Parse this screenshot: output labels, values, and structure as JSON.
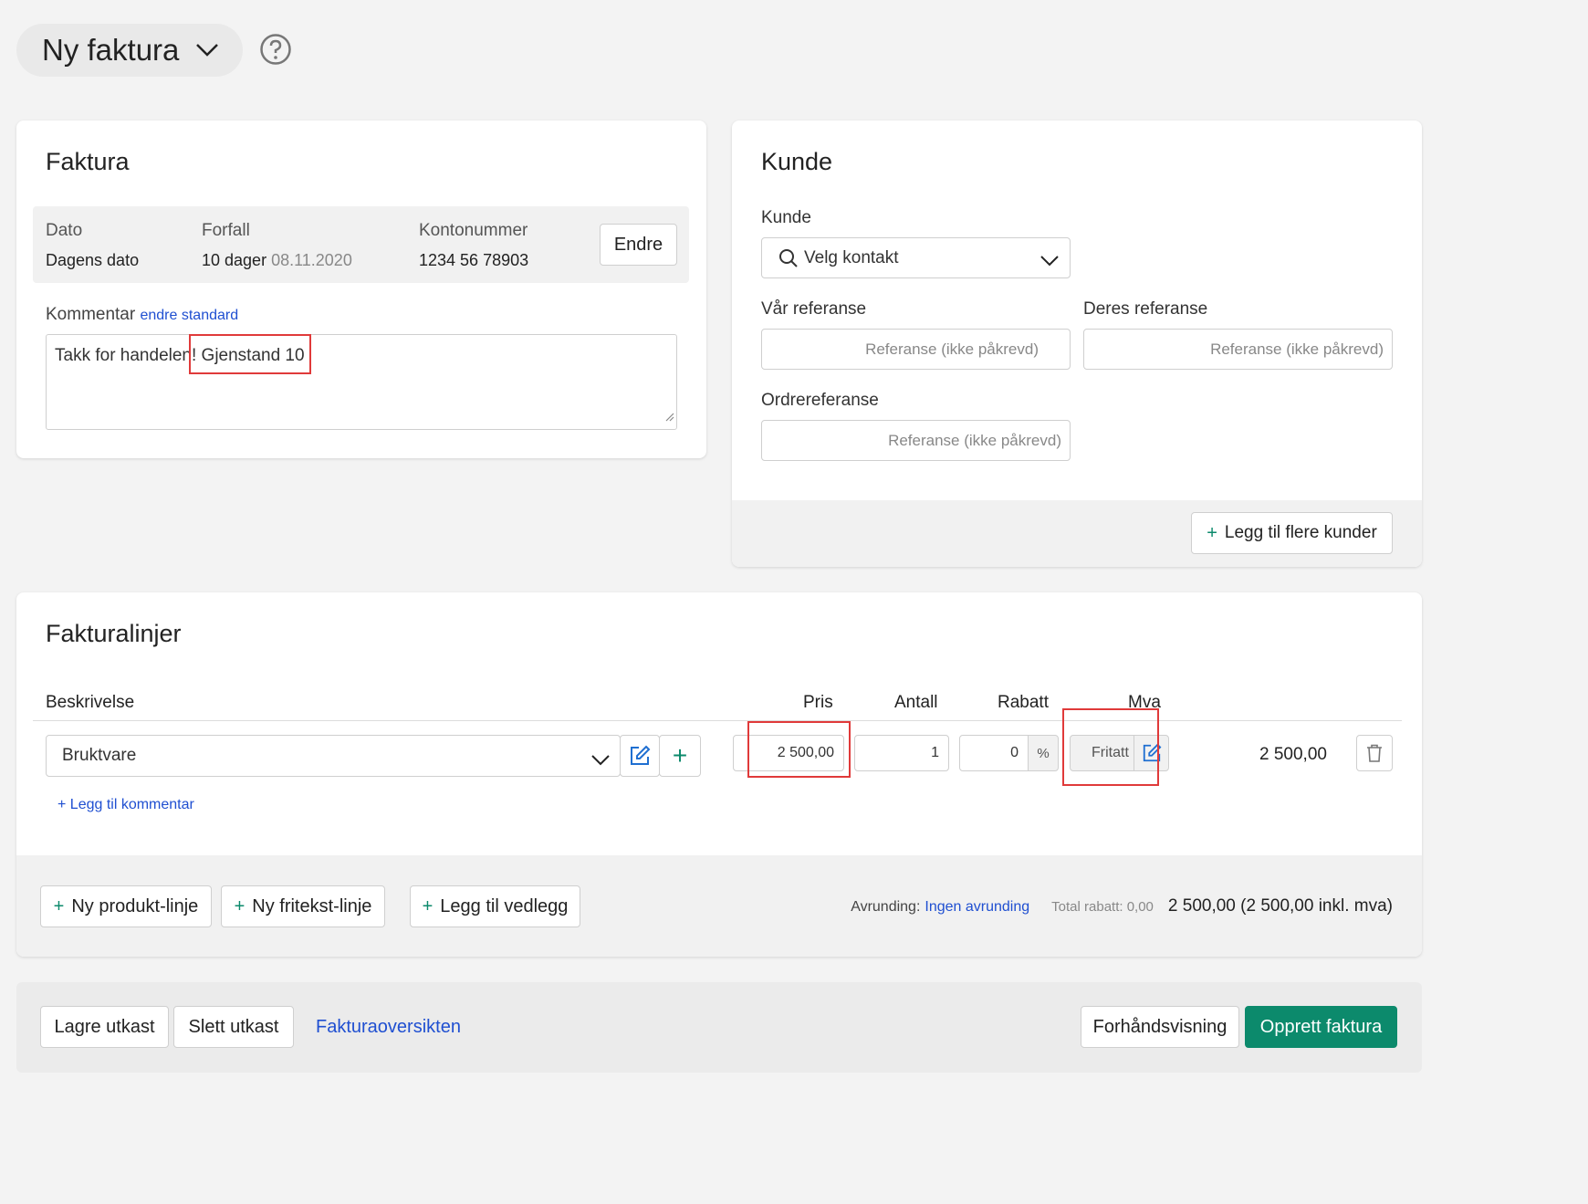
{
  "header": {
    "title": "Ny faktura"
  },
  "faktura": {
    "title": "Faktura",
    "dato_label": "Dato",
    "dato_value": "Dagens dato",
    "forfall_label": "Forfall",
    "forfall_value": "10 dager",
    "forfall_date": "08.11.2020",
    "konto_label": "Kontonummer",
    "konto_value": "1234 56 78903",
    "endre_label": "Endre",
    "kommentar_label": "Kommentar",
    "kommentar_link": "endre standard",
    "kommentar_text": "Takk for handelen! Gjenstand 10"
  },
  "kunde": {
    "title": "Kunde",
    "kunde_label": "Kunde",
    "kunde_placeholder": "Velg kontakt",
    "var_ref_label": "Vår referanse",
    "deres_ref_label": "Deres referanse",
    "ordre_ref_label": "Ordrereferanse",
    "ref_placeholder": "Referanse (ikke påkrevd)",
    "add_more_label": "Legg til flere kunder"
  },
  "lines": {
    "title": "Fakturalinjer",
    "columns": {
      "beskrivelse": "Beskrivelse",
      "pris": "Pris",
      "antall": "Antall",
      "rabatt": "Rabatt",
      "mva": "Mva"
    },
    "row": {
      "product": "Bruktvare",
      "price": "2 500,00",
      "quantity": "1",
      "discount": "0",
      "discount_unit": "%",
      "mva": "Fritatt",
      "total": "2 500,00"
    },
    "add_comment": "+ Legg til kommentar",
    "buttons": {
      "product_line": "Ny produkt-linje",
      "text_line": "Ny fritekst-linje",
      "attachment": "Legg til vedlegg"
    },
    "rounding_label": "Avrunding:",
    "rounding_value": "Ingen avrunding",
    "total_discount": "Total rabatt: 0,00",
    "grand_total": "2 500,00 (2 500,00 inkl. mva)"
  },
  "footer": {
    "save_draft": "Lagre utkast",
    "delete_draft": "Slett utkast",
    "overview_link": "Fakturaoversikten",
    "preview": "Forhåndsvisning",
    "create": "Opprett faktura"
  },
  "colors": {
    "accent_green": "#0c8a6c",
    "link_blue": "#1f4fd1",
    "highlight_red": "#e03a3a"
  }
}
